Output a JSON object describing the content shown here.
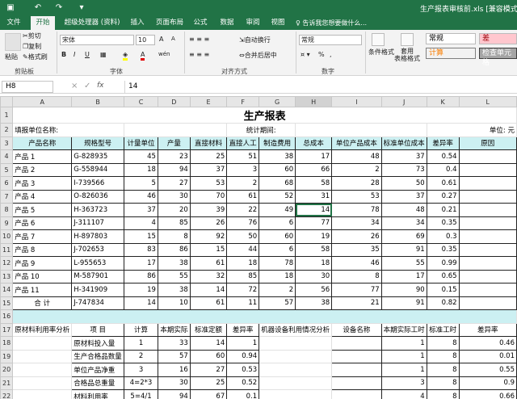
{
  "window": {
    "title": "生产报表审核前.xls  [兼容模式]  - Exc"
  },
  "qat": [
    "save-icon",
    "undo-icon",
    "redo-icon",
    "customize-icon"
  ],
  "tabs": [
    "文件",
    "开始",
    "超级处理器 (资料)",
    "插入",
    "页面布局",
    "公式",
    "数据",
    "审阅",
    "视图"
  ],
  "tell_me": "告诉我您想要做什么...",
  "ribbon": {
    "cut": "剪切",
    "copy": "复制",
    "format_painter": "格式刷",
    "paste": "粘贴",
    "clipboard_group": "剪贴板",
    "font_group": "字体",
    "align_group": "对齐方式",
    "number_group": "数字",
    "font_name": "宋体",
    "font_size": "10",
    "bold": "B",
    "italic": "I",
    "underline": "U",
    "grow": "A",
    "shrink": "A",
    "wen": "wén",
    "wrap": "自动换行",
    "merge": "合并后居中",
    "number_format": "常规",
    "currency": "%",
    "comma": ",",
    "cond_format": "条件格式",
    "table_format": "套用\n表格格式",
    "style_normal": "常规",
    "style_bad": "差",
    "style_calc": "计算",
    "style_check": "检查单元格"
  },
  "formula": {
    "cell_ref": "H8",
    "cancel": "×",
    "enter": "✓",
    "fx": "fx",
    "value": "14"
  },
  "columns": [
    "A",
    "B",
    "C",
    "D",
    "E",
    "F",
    "G",
    "H",
    "I",
    "J",
    "K",
    "L"
  ],
  "title": "生产报表",
  "row2": {
    "unit_label": "填报单位名称:",
    "period": "统计期间:",
    "unit": "单位: 元"
  },
  "headers": [
    "产品名称",
    "规格型号",
    "计量单位",
    "产量",
    "直接材料",
    "直接人工",
    "制造费用",
    "总成本",
    "单位产品成本",
    "标准单位成本",
    "差异率",
    "原因"
  ],
  "products": [
    [
      "产品 1",
      "G-828935",
      "45",
      "23",
      "25",
      "51",
      "38",
      "17",
      "48",
      "37",
      "0.54",
      ""
    ],
    [
      "产品 2",
      "G-558944",
      "18",
      "94",
      "37",
      "3",
      "60",
      "66",
      "2",
      "73",
      "0.4",
      ""
    ],
    [
      "产品 3",
      "I-739566",
      "5",
      "27",
      "53",
      "2",
      "68",
      "58",
      "28",
      "50",
      "0.61",
      ""
    ],
    [
      "产品 4",
      "O-826036",
      "46",
      "30",
      "70",
      "61",
      "52",
      "31",
      "53",
      "37",
      "0.27",
      ""
    ],
    [
      "产品 5",
      "H-363723",
      "37",
      "20",
      "39",
      "22",
      "49",
      "14",
      "78",
      "48",
      "0.21",
      ""
    ],
    [
      "产品 6",
      "J-311107",
      "4",
      "85",
      "26",
      "76",
      "6",
      "77",
      "34",
      "34",
      "0.35",
      ""
    ],
    [
      "产品 7",
      "H-897803",
      "15",
      "8",
      "92",
      "50",
      "60",
      "19",
      "26",
      "69",
      "0.3",
      ""
    ],
    [
      "产品 8",
      "J-702653",
      "83",
      "86",
      "15",
      "44",
      "6",
      "58",
      "35",
      "91",
      "0.35",
      ""
    ],
    [
      "产品 9",
      "L-955653",
      "17",
      "38",
      "61",
      "18",
      "78",
      "18",
      "46",
      "55",
      "0.99",
      ""
    ],
    [
      "产品 10",
      "M-587901",
      "86",
      "55",
      "32",
      "85",
      "18",
      "30",
      "8",
      "17",
      "0.65",
      ""
    ],
    [
      "产品 11",
      "H-341909",
      "19",
      "38",
      "14",
      "72",
      "2",
      "56",
      "77",
      "90",
      "0.15",
      ""
    ],
    [
      "合    计",
      "J-747834",
      "14",
      "10",
      "61",
      "11",
      "57",
      "38",
      "21",
      "91",
      "0.82",
      ""
    ]
  ],
  "analysis": {
    "material_title": "原材料利用率分析",
    "item": "项    目",
    "calc": "计算",
    "actual": "本期实际",
    "standard": "标准定额",
    "diff": "差异率",
    "machine_title": "机器设备利用情况分析",
    "device": "设备名称",
    "actual_hours": "本期实际工时",
    "std_hours": "标准工时",
    "diff2": "差异率",
    "rows": [
      [
        "原材料投入量",
        "1",
        "33",
        "14",
        "1",
        "",
        "1",
        "8",
        "0.46"
      ],
      [
        "生产合格品数量",
        "2",
        "57",
        "60",
        "0.94",
        "",
        "1",
        "8",
        "0.01"
      ],
      [
        "单位产品净重",
        "3",
        "16",
        "27",
        "0.53",
        "",
        "1",
        "8",
        "0.55"
      ],
      [
        "合格品总重量",
        "4=2*3",
        "30",
        "25",
        "0.52",
        "",
        "3",
        "8",
        "0.9"
      ],
      [
        "材料利用率",
        "5=4/1",
        "94",
        "67",
        "0.1",
        "",
        "4",
        "8",
        "0.66"
      ],
      [
        "收回残值(%)",
        "6",
        "11",
        "56",
        "0.75",
        "",
        "7",
        "8",
        "0.49"
      ]
    ]
  },
  "row_numbers": [
    "1",
    "2",
    "3",
    "4",
    "5",
    "6",
    "7",
    "8",
    "9",
    "10",
    "11",
    "12",
    "13",
    "14",
    "15",
    "16",
    "17",
    "18",
    "19",
    "20",
    "21",
    "22",
    "23"
  ]
}
